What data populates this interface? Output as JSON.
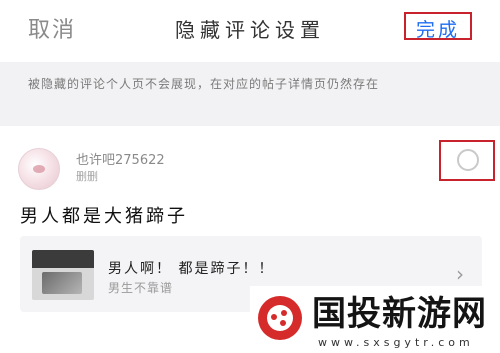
{
  "header": {
    "cancel_label": "取消",
    "title": "隐藏评论设置",
    "done_label": "完成"
  },
  "notice": "被隐藏的评论个人页不会展现，在对应的帖子详情页仍然存在",
  "comment": {
    "username": "也许吧275622",
    "status": "删删",
    "text": "男人都是大猪蹄子"
  },
  "post": {
    "title": "男人啊！ 都是蹄子！！",
    "subtitle": "男生不靠谱"
  },
  "watermark": {
    "name": "国投新游网",
    "url": "www.sxsgytr.com"
  },
  "colors": {
    "accent": "#1f6df2",
    "highlight_box": "#c8232c"
  }
}
